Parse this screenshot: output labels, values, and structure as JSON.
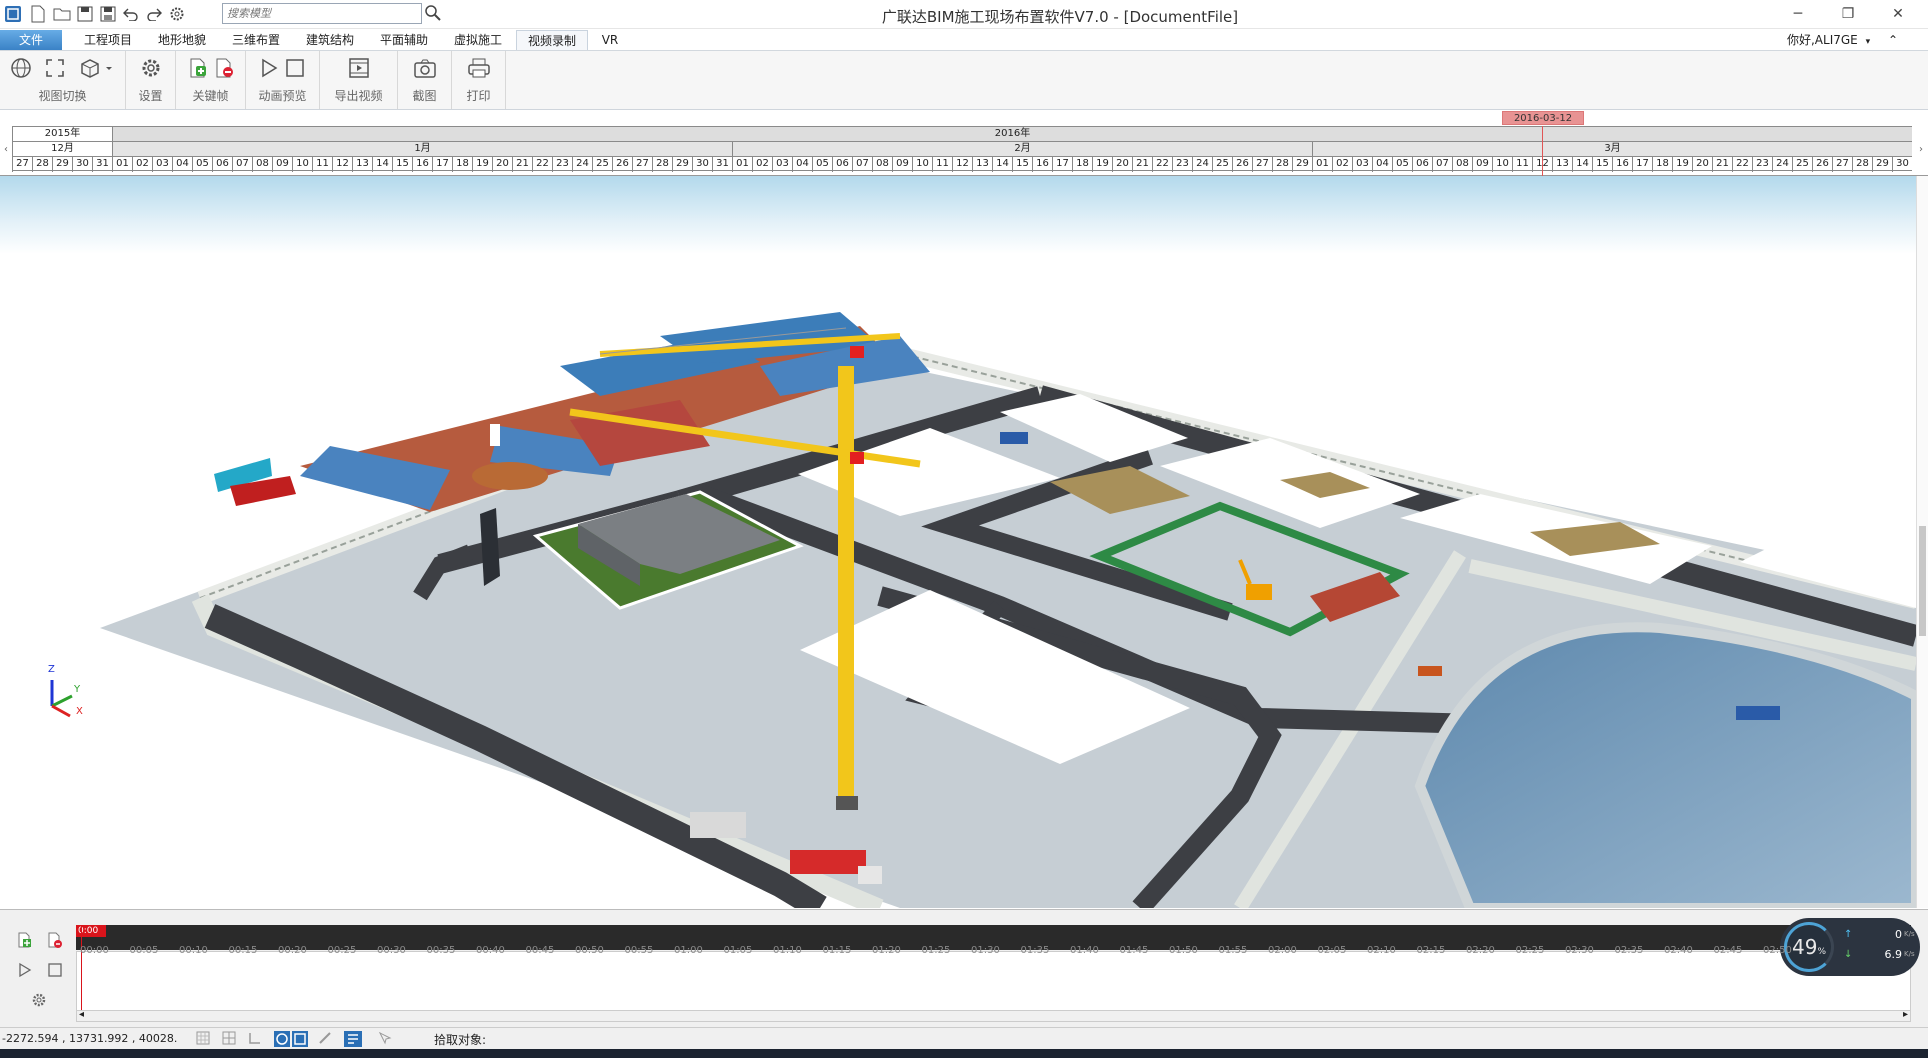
{
  "title_bar": {
    "title": "广联达BIM施工现场布置软件V7.0 - [DocumentFile]",
    "search_placeholder": "搜索模型",
    "quick_access_icons": [
      "app-logo-icon",
      "new-file-icon",
      "open-folder-icon",
      "save-icon",
      "save-as-icon",
      "undo-icon",
      "redo-icon",
      "settings-icon"
    ],
    "window_controls": {
      "minimize": "─",
      "restore": "❐",
      "close": "✕"
    }
  },
  "menu": {
    "tabs": [
      "文件",
      "工程项目",
      "地形地貌",
      "三维布置",
      "建筑结构",
      "平面辅助",
      "虚拟施工",
      "视频录制",
      "VR"
    ],
    "active": "视频录制",
    "user": "你好,ALI7GE",
    "user_caret": "▾",
    "collapse_caret": "⌃"
  },
  "ribbon": {
    "groups": [
      {
        "label": "视图切换"
      },
      {
        "label": "设置"
      },
      {
        "label": "关键帧"
      },
      {
        "label": "动画预览"
      },
      {
        "label": "导出视频"
      },
      {
        "label": "截图"
      },
      {
        "label": "打印"
      }
    ]
  },
  "timeline": {
    "marker_date": "2016-03-12",
    "years": [
      "2015年",
      "2016年"
    ],
    "months": [
      "12月",
      "1月",
      "2月",
      "3月"
    ],
    "days_dec": [
      "27",
      "28",
      "29",
      "30",
      "31"
    ],
    "days_jan": [
      "01",
      "02",
      "03",
      "04",
      "05",
      "06",
      "07",
      "08",
      "09",
      "10",
      "11",
      "12",
      "13",
      "14",
      "15",
      "16",
      "17",
      "18",
      "19",
      "20",
      "21",
      "22",
      "23",
      "24",
      "25",
      "26",
      "27",
      "28",
      "29",
      "30",
      "31"
    ],
    "days_feb": [
      "01",
      "02",
      "03",
      "04",
      "05",
      "06",
      "07",
      "08",
      "09",
      "10",
      "11",
      "12",
      "13",
      "14",
      "15",
      "16",
      "17",
      "18",
      "19",
      "20",
      "21",
      "22",
      "23",
      "24",
      "25",
      "26",
      "27",
      "28",
      "29"
    ],
    "days_mar": [
      "01",
      "02",
      "03",
      "04",
      "05",
      "06",
      "07",
      "08",
      "09",
      "10",
      "11",
      "12",
      "13",
      "14",
      "15",
      "16",
      "17",
      "18",
      "19",
      "20",
      "21",
      "22",
      "23",
      "24",
      "25",
      "26",
      "27",
      "28",
      "29",
      "30"
    ],
    "scroll_left": "‹",
    "scroll_right": "›"
  },
  "axis": {
    "z": "Z",
    "y": "Y",
    "x": "X"
  },
  "animation": {
    "playhead_label": "0:00",
    "ticks": [
      "00:00",
      "00:05",
      "00:10",
      "00:15",
      "00:20",
      "00:25",
      "00:30",
      "00:35",
      "00:40",
      "00:45",
      "00:50",
      "00:55",
      "01:00",
      "01:05",
      "01:10",
      "01:15",
      "01:20",
      "01:25",
      "01:30",
      "01:35",
      "01:40",
      "01:45",
      "01:50",
      "01:55",
      "02:00",
      "02:05",
      "02:10",
      "02:15",
      "02:20",
      "02:25",
      "02:30",
      "02:35",
      "02:40",
      "02:45",
      "02:50"
    ],
    "scroll_left": "◂",
    "scroll_right": "▸"
  },
  "net_monitor": {
    "percent": "49",
    "percent_unit": "%",
    "up": "0",
    "up_unit": "K/s",
    "down": "6.9",
    "down_unit": "K/s",
    "up_arrow": "↑",
    "down_arrow": "↓"
  },
  "status": {
    "coords": "-2272.594 , 13731.992 , 40028.",
    "pick_label": "拾取对象:"
  },
  "colors": {
    "accent": "#4c9adb",
    "date_marker": "#e89393",
    "playhead": "#d9141b",
    "crane": "#f2c61b",
    "ground": "#c5cdd2",
    "road": "#3d3f44"
  }
}
